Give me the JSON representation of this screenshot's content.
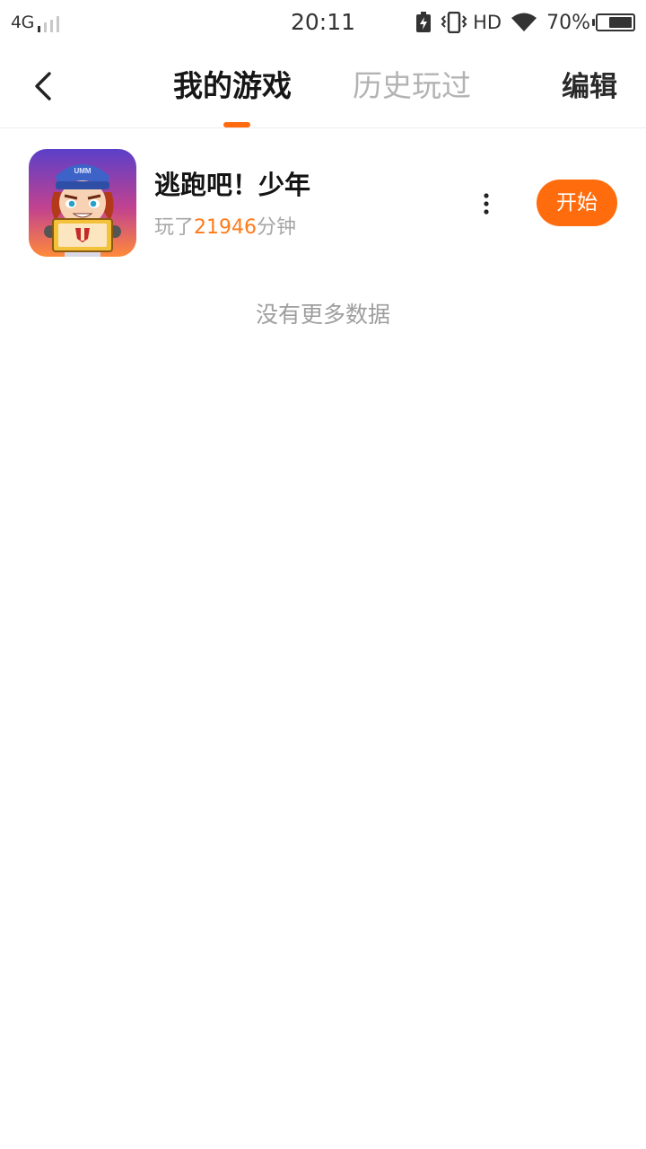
{
  "status_bar": {
    "network": "4G",
    "time": "20:11",
    "hd_label": "HD",
    "battery_percent_text": "70%",
    "battery_level": 0.7,
    "icons": [
      "signal-icon",
      "battery-saver-icon",
      "vibrate-icon",
      "wifi-icon",
      "battery-icon"
    ]
  },
  "header": {
    "back_icon": "chevron-left-icon",
    "tabs": [
      {
        "label": "我的游戏",
        "active": true
      },
      {
        "label": "历史玩过",
        "active": false
      }
    ],
    "edit_label": "编辑",
    "accent_color": "#ff6a0f"
  },
  "games": [
    {
      "title": "逃跑吧！少年",
      "played_prefix": "玩了",
      "played_minutes": "21946",
      "played_suffix": "分钟",
      "more_icon": "more-vertical-icon",
      "start_label": "开始",
      "cap_text": "UMM"
    }
  ],
  "list_footer": "没有更多数据",
  "colors": {
    "start_button": "#ff6c0d",
    "minutes_highlight": "#ff7a1a",
    "inactive_tab": "#b3b3b3"
  }
}
